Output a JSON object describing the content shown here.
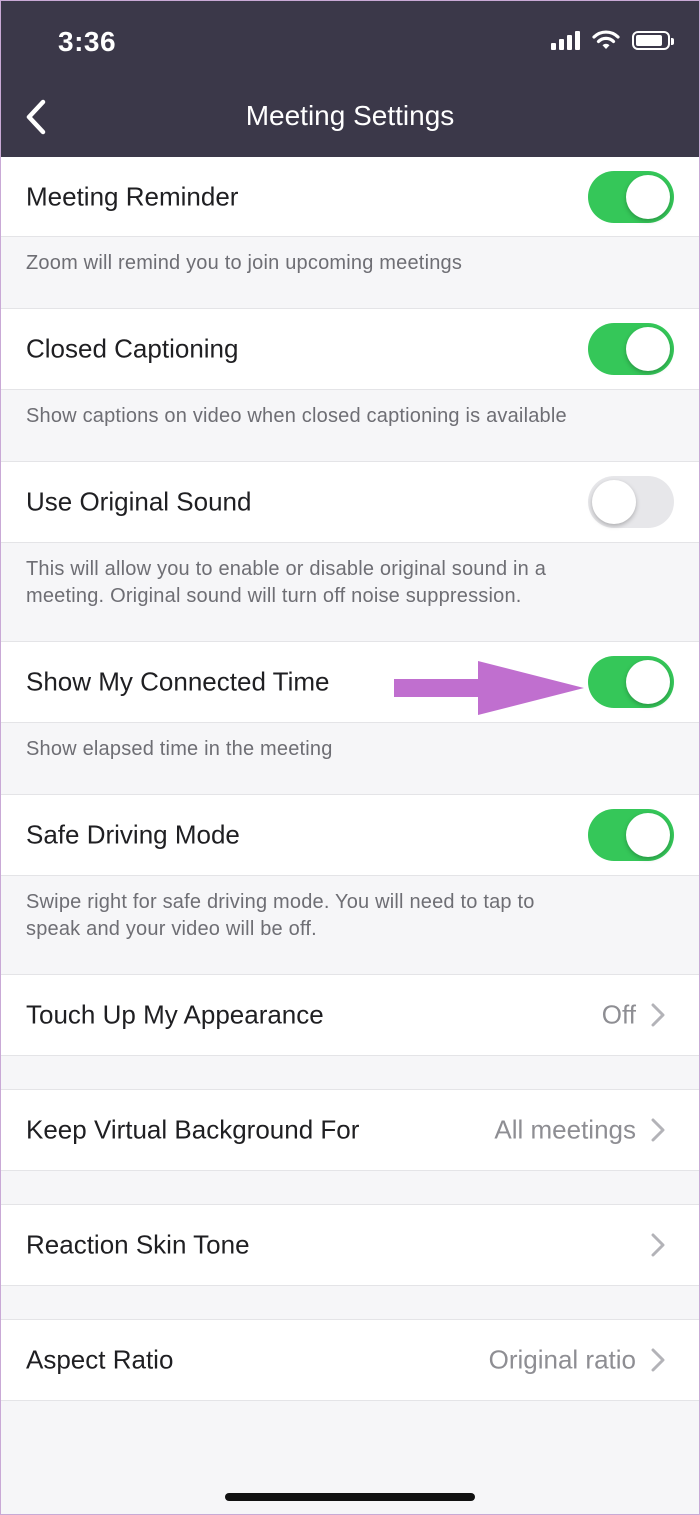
{
  "status_bar": {
    "time": "3:36"
  },
  "header": {
    "title": "Meeting Settings"
  },
  "settings": {
    "meeting_reminder": {
      "title": "Meeting Reminder",
      "description": "Zoom will remind you to join upcoming meetings",
      "enabled": true
    },
    "closed_captioning": {
      "title": "Closed Captioning",
      "description": "Show captions on video when closed captioning is available",
      "enabled": true
    },
    "original_sound": {
      "title": "Use Original Sound",
      "description_line1": "This will allow you to enable or disable original sound in a",
      "description_line2": "meeting. Original sound will turn off noise suppression.",
      "enabled": false
    },
    "connected_time": {
      "title": "Show My Connected Time",
      "description": "Show elapsed time in the meeting",
      "enabled": true
    },
    "safe_driving": {
      "title": "Safe Driving Mode",
      "description_line1": "Swipe right for safe driving mode. You will need to tap to",
      "description_line2": "speak and your video will be off.",
      "enabled": true
    },
    "touch_up": {
      "title": "Touch Up My Appearance",
      "value": "Off"
    },
    "virtual_background": {
      "title": "Keep Virtual Background For",
      "value": "All meetings"
    },
    "reaction_skin_tone": {
      "title": "Reaction Skin Tone",
      "value": ""
    },
    "aspect_ratio": {
      "title": "Aspect Ratio",
      "value": "Original ratio"
    }
  },
  "colors": {
    "header_bg": "#3b3849",
    "toggle_on": "#35c759",
    "toggle_off": "#e7e7ea",
    "arrow": "#c06fcf"
  },
  "icons": {
    "back": "chevron-left-icon",
    "nav": "chevron-right-icon",
    "annotation": "arrow-right-icon"
  }
}
